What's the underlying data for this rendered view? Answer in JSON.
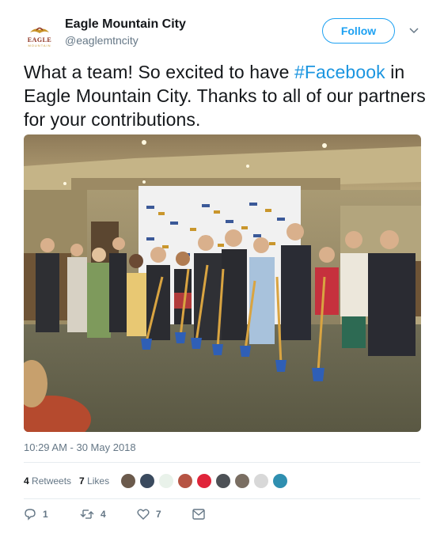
{
  "account": {
    "name": "Eagle Mountain City",
    "handle": "@eaglemtncity",
    "logo_text": "EAGLE",
    "logo_subtext": "MOUNTAIN"
  },
  "follow_button": {
    "label": "Follow"
  },
  "tweet": {
    "text_before": "What a team! So excited to have ",
    "hashtag": "#Facebook",
    "text_after": " in Eagle Mountain City. Thanks to all of our partners for your contributions.",
    "timestamp": "10:29 AM - 30 May 2018"
  },
  "engagement": {
    "retweets_count": "4",
    "retweets_label": " Retweets",
    "likes_count": "7",
    "likes_label": " Likes",
    "liker_colors": [
      "#6b5a4c",
      "#3a4a5e",
      "#e9f2ea",
      "#b65443",
      "#e0243a",
      "#4d5156",
      "#7a6e62",
      "#d8d8d8",
      "#2f8fb0"
    ]
  },
  "actions": {
    "reply_count": "1",
    "retweet_count": "4",
    "like_count": "7"
  },
  "colors": {
    "accent": "#1da1f2",
    "hashtag": "#1b95e0",
    "secondary_text": "#657786"
  }
}
